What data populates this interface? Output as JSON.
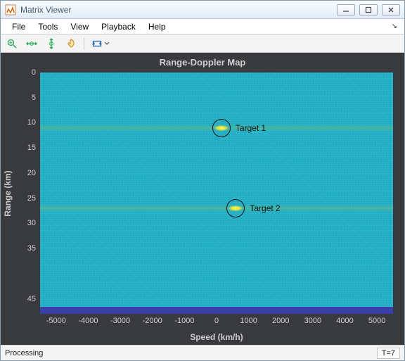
{
  "window": {
    "title": "Matrix Viewer"
  },
  "menu": {
    "file": "File",
    "tools": "Tools",
    "view": "View",
    "playback": "Playback",
    "help": "Help"
  },
  "toolbar_icons": {
    "zoom_in": "zoom-in-icon",
    "zoom_x": "zoom-x-icon",
    "zoom_y": "zoom-y-icon",
    "pan": "pan-icon",
    "autoscale": "autoscale-icon"
  },
  "status": {
    "left": "Processing",
    "right": "T=7"
  },
  "chart_data": {
    "type": "heatmap",
    "title": "Range-Doppler Map",
    "xlabel": "Speed (km/h)",
    "ylabel": "Range (km)",
    "xlim": [
      -5500,
      5500
    ],
    "ylim": [
      0,
      48
    ],
    "y_reversed": true,
    "x_ticks": [
      -5000,
      -4000,
      -3000,
      -2000,
      -1000,
      0,
      1000,
      2000,
      3000,
      4000,
      5000
    ],
    "y_ticks": [
      0,
      5,
      10,
      15,
      20,
      25,
      30,
      35,
      45
    ],
    "annotations": [
      {
        "label": "Target 1",
        "speed": 150,
        "range": 11
      },
      {
        "label": "Target 2",
        "speed": 600,
        "range": 27
      }
    ],
    "background_level": "low",
    "legend_position": "none"
  }
}
